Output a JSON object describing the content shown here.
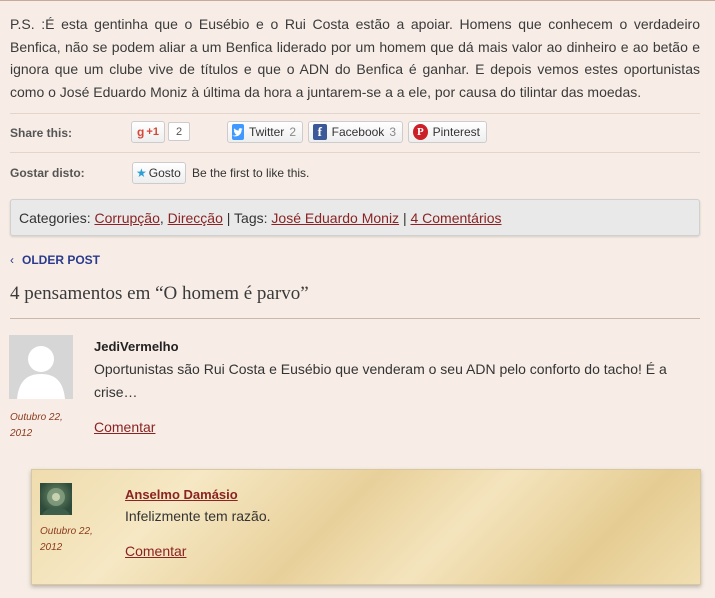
{
  "post": {
    "ps_text": "P.S. :É esta gentinha que o Eusébio e o Rui Costa estão a apoiar. Homens que conhecem o verdadeiro Benfica, não se podem aliar a um Benfica liderado por um homem que dá mais valor ao dinheiro e ao betão e ignora que um clube vive de títulos e que o ADN do Benfica é ganhar. E depois vemos estes oportunistas como o José Eduardo Moniz à última da hora a juntarem-se a a ele, por causa do tilintar das moedas."
  },
  "share": {
    "label": "Share this:",
    "gplus_label": "+1",
    "gplus_count": "2",
    "buttons": [
      {
        "label": "Twitter",
        "count": "2",
        "icon": "twitter-icon",
        "color": "#4099ff"
      },
      {
        "label": "Facebook",
        "count": "3",
        "icon": "facebook-icon",
        "color": "#3b5998"
      },
      {
        "label": "Pinterest",
        "count": "",
        "icon": "pinterest-icon",
        "color": "#cb2027"
      }
    ]
  },
  "like": {
    "label": "Gostar disto:",
    "button_label": "Gosto",
    "text": "Be the first to like this."
  },
  "meta": {
    "categories_label": "Categories:",
    "categories": [
      "Corrupção",
      "Direcção"
    ],
    "tags_label": "| Tags:",
    "tags": [
      "José Eduardo Moniz"
    ],
    "comments_link": "4 Comentários"
  },
  "nav": {
    "older_arrow": "‹",
    "older_label": "OLDER POST"
  },
  "comments": {
    "title": "4 pensamentos em “O homem é parvo”",
    "items": [
      {
        "author": "JediVermelho",
        "date_line1": "Outubro 22,",
        "date_line2": "2012",
        "text": "Oportunistas são Rui Costa e Eusébio que venderam o seu ADN pelo conforto do tacho! É a crise…",
        "reply_label": "Comentar"
      },
      {
        "author": "Anselmo Damásio",
        "date_line1": "Outubro 22,",
        "date_line2": "2012",
        "text": "Infelizmente tem razão.",
        "reply_label": "Comentar"
      }
    ]
  },
  "colors": {
    "link": "#8a2323",
    "nav_link": "#2a3b8e",
    "background": "#f7ede6",
    "paper": "#efdcae"
  }
}
